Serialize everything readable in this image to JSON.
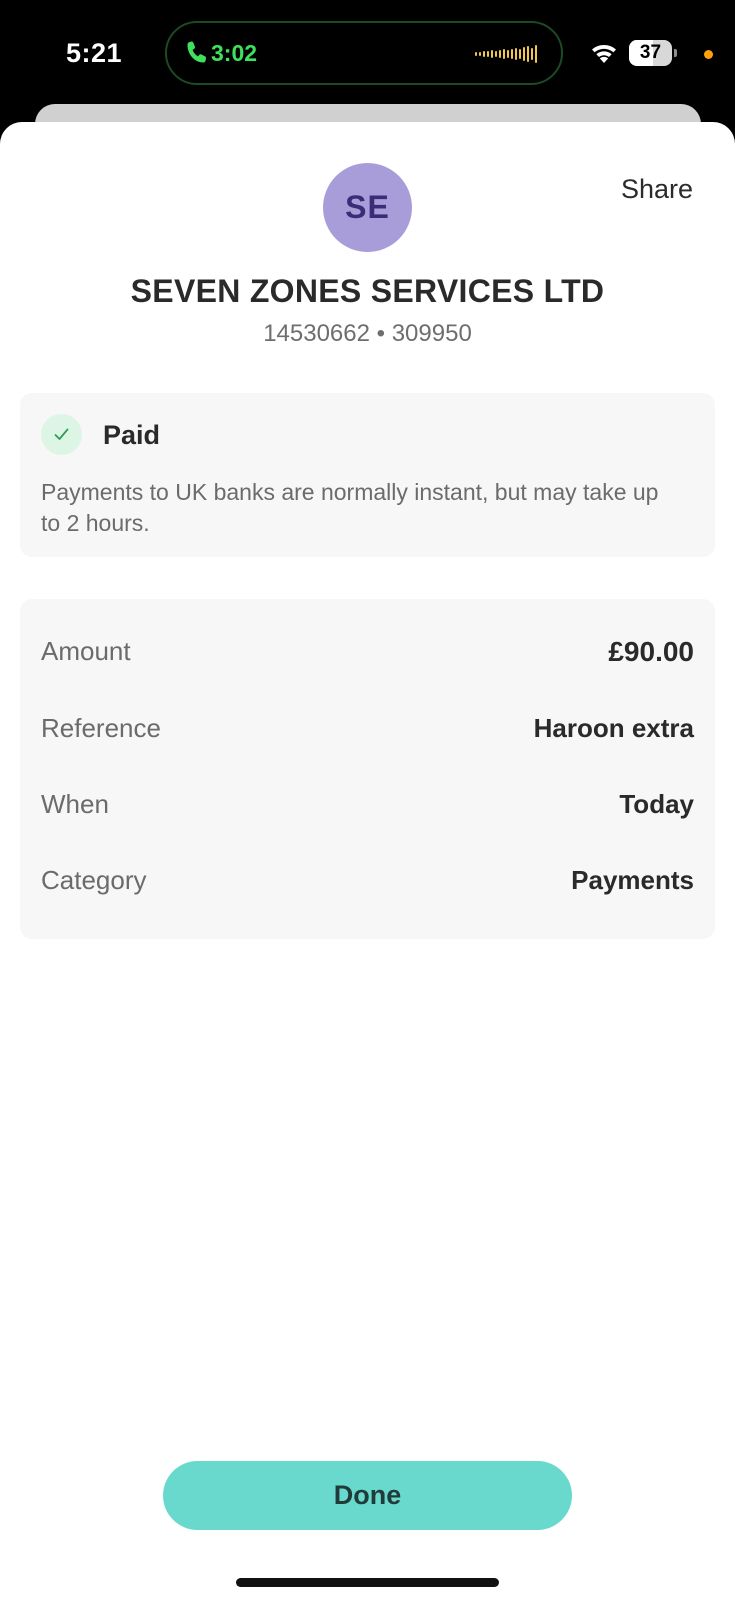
{
  "status_bar": {
    "time": "5:21",
    "call_timer": "3:02",
    "battery_level": "37",
    "call_color": "#3fe05d",
    "privacy_dot_color": "#ff9f0a"
  },
  "header": {
    "share_label": "Share",
    "avatar_initials": "SE",
    "avatar_color": "#a99dd9",
    "payee_name": "SEVEN ZONES SERVICES LTD",
    "account_info": "14530662 • 309950"
  },
  "status": {
    "title": "Paid",
    "icon": "check-icon",
    "description": "Payments to UK banks are normally instant, but may take up to 2 hours."
  },
  "details": [
    {
      "label": "Amount",
      "value": "£90.00"
    },
    {
      "label": "Reference",
      "value": "Haroon extra"
    },
    {
      "label": "When",
      "value": "Today"
    },
    {
      "label": "Category",
      "value": "Payments"
    }
  ],
  "footer": {
    "done_label": "Done",
    "done_color": "#6ad9cd"
  }
}
